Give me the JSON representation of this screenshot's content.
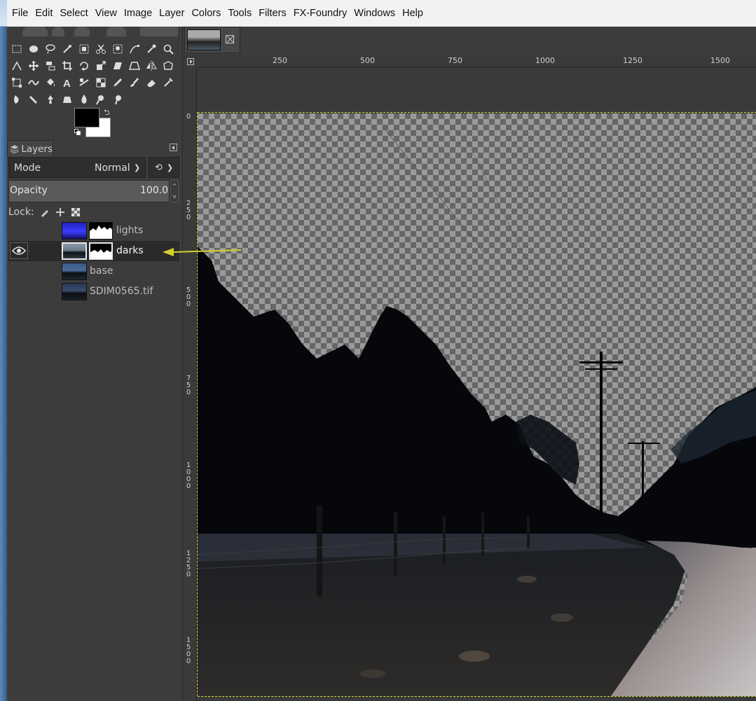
{
  "menu": [
    "File",
    "Edit",
    "Select",
    "View",
    "Image",
    "Layer",
    "Colors",
    "Tools",
    "Filters",
    "FX-Foundry",
    "Windows",
    "Help"
  ],
  "toolbox": {
    "tools": [
      "rect-select-icon",
      "ellipse-select-icon",
      "lasso-icon",
      "fuzzy-select-icon",
      "color-select-icon",
      "scissors-icon",
      "foreground-select-icon",
      "paths-icon",
      "color-picker-icon",
      "zoom-icon",
      "measure-icon",
      "move-icon",
      "align-icon",
      "crop-icon",
      "rotate-icon",
      "scale-icon",
      "shear-icon",
      "perspective-icon",
      "flip-icon",
      "cage-icon",
      "unified-transform-icon",
      "warp-icon",
      "bucket-fill-icon",
      "text-icon",
      "blend-icon",
      "gradient-icon",
      "pencil-icon",
      "paintbrush-icon",
      "eraser-icon",
      "airbrush-icon",
      "ink-icon",
      "heal-icon",
      "clone-icon",
      "perspective-clone-icon",
      "blur-icon",
      "smudge-icon",
      "dodge-icon"
    ],
    "fg_color": "#000000",
    "bg_color": "#ffffff"
  },
  "layers_panel": {
    "tab_label": "Layers",
    "mode_label": "Mode",
    "mode_value": "Normal",
    "opacity_label": "Opacity",
    "opacity_value": "100.0",
    "lock_label": "Lock:",
    "layers": [
      {
        "name": "lights",
        "visible": false,
        "active": false,
        "has_mask": true
      },
      {
        "name": "darks",
        "visible": true,
        "active": true,
        "has_mask": true
      },
      {
        "name": "base",
        "visible": false,
        "active": false,
        "has_mask": false
      },
      {
        "name": "SDIM0565.tif",
        "visible": false,
        "active": false,
        "has_mask": false
      }
    ]
  },
  "rulers": {
    "horizontal": [
      "250",
      "500",
      "750",
      "1000",
      "1250",
      "1500"
    ],
    "vertical": [
      "0",
      "250",
      "500",
      "750",
      "1000",
      "1250",
      "1500"
    ]
  },
  "colors": {
    "annotation_arrow": "#d4d12e",
    "selection_outline": "#d6d23a"
  }
}
